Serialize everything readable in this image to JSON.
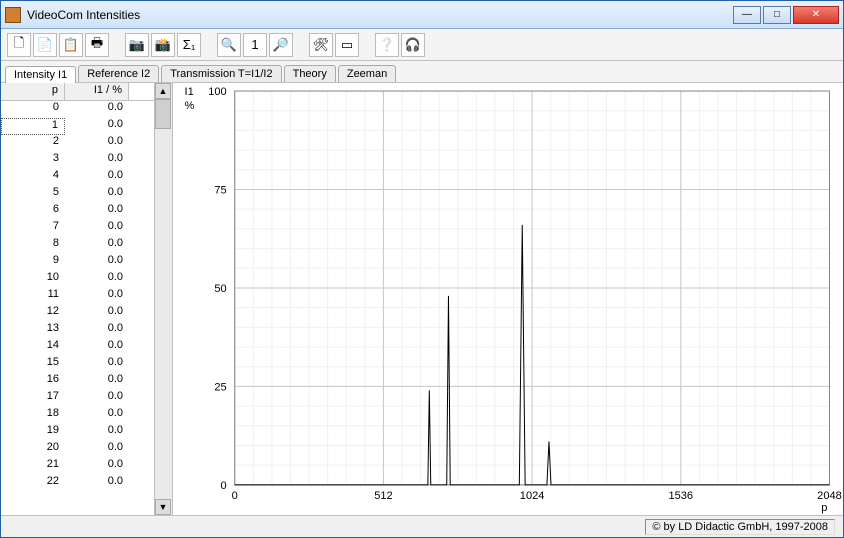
{
  "window": {
    "title": "VideoCom Intensities"
  },
  "tabs": [
    {
      "label": "Intensity I1",
      "active": true
    },
    {
      "label": "Reference I2",
      "active": false
    },
    {
      "label": "Transmission T=I1/I2",
      "active": false
    },
    {
      "label": "Theory",
      "active": false
    },
    {
      "label": "Zeeman",
      "active": false
    }
  ],
  "table": {
    "col1": "p",
    "col2": "I1 / %",
    "rows": [
      {
        "p": "0",
        "v": "0.0"
      },
      {
        "p": "1",
        "v": "0.0"
      },
      {
        "p": "2",
        "v": "0.0"
      },
      {
        "p": "3",
        "v": "0.0"
      },
      {
        "p": "4",
        "v": "0.0"
      },
      {
        "p": "5",
        "v": "0.0"
      },
      {
        "p": "6",
        "v": "0.0"
      },
      {
        "p": "7",
        "v": "0.0"
      },
      {
        "p": "8",
        "v": "0.0"
      },
      {
        "p": "9",
        "v": "0.0"
      },
      {
        "p": "10",
        "v": "0.0"
      },
      {
        "p": "11",
        "v": "0.0"
      },
      {
        "p": "12",
        "v": "0.0"
      },
      {
        "p": "13",
        "v": "0.0"
      },
      {
        "p": "14",
        "v": "0.0"
      },
      {
        "p": "15",
        "v": "0.0"
      },
      {
        "p": "16",
        "v": "0.0"
      },
      {
        "p": "17",
        "v": "0.0"
      },
      {
        "p": "18",
        "v": "0.0"
      },
      {
        "p": "19",
        "v": "0.0"
      },
      {
        "p": "20",
        "v": "0.0"
      },
      {
        "p": "21",
        "v": "0.0"
      },
      {
        "p": "22",
        "v": "0.0"
      }
    ],
    "selected_row": 1
  },
  "toolbar_icons": [
    "new",
    "open",
    "copy",
    "print",
    "sep",
    "record",
    "record2",
    "sigma",
    "sep",
    "zoom-in",
    "one",
    "zoom-out",
    "sep",
    "tools",
    "window",
    "sep",
    "help",
    "headset"
  ],
  "status": {
    "copyright": "© by LD Didactic GmbH, 1997-2008"
  },
  "chart_data": {
    "type": "line",
    "title": "",
    "xlabel": "p",
    "ylabel": "I1\n%",
    "xlim": [
      0,
      2048
    ],
    "ylim": [
      0,
      100
    ],
    "xticks": [
      0,
      512,
      1024,
      1536,
      2048
    ],
    "yticks": [
      0,
      25,
      50,
      75,
      100
    ],
    "grid": true,
    "x": [
      0,
      512,
      665,
      670,
      675,
      730,
      736,
      742,
      980,
      990,
      1000,
      1075,
      1082,
      1089,
      2048
    ],
    "y": [
      0,
      0,
      0,
      24,
      0,
      0,
      48,
      0,
      0,
      66,
      0,
      0,
      11,
      0,
      0
    ]
  }
}
